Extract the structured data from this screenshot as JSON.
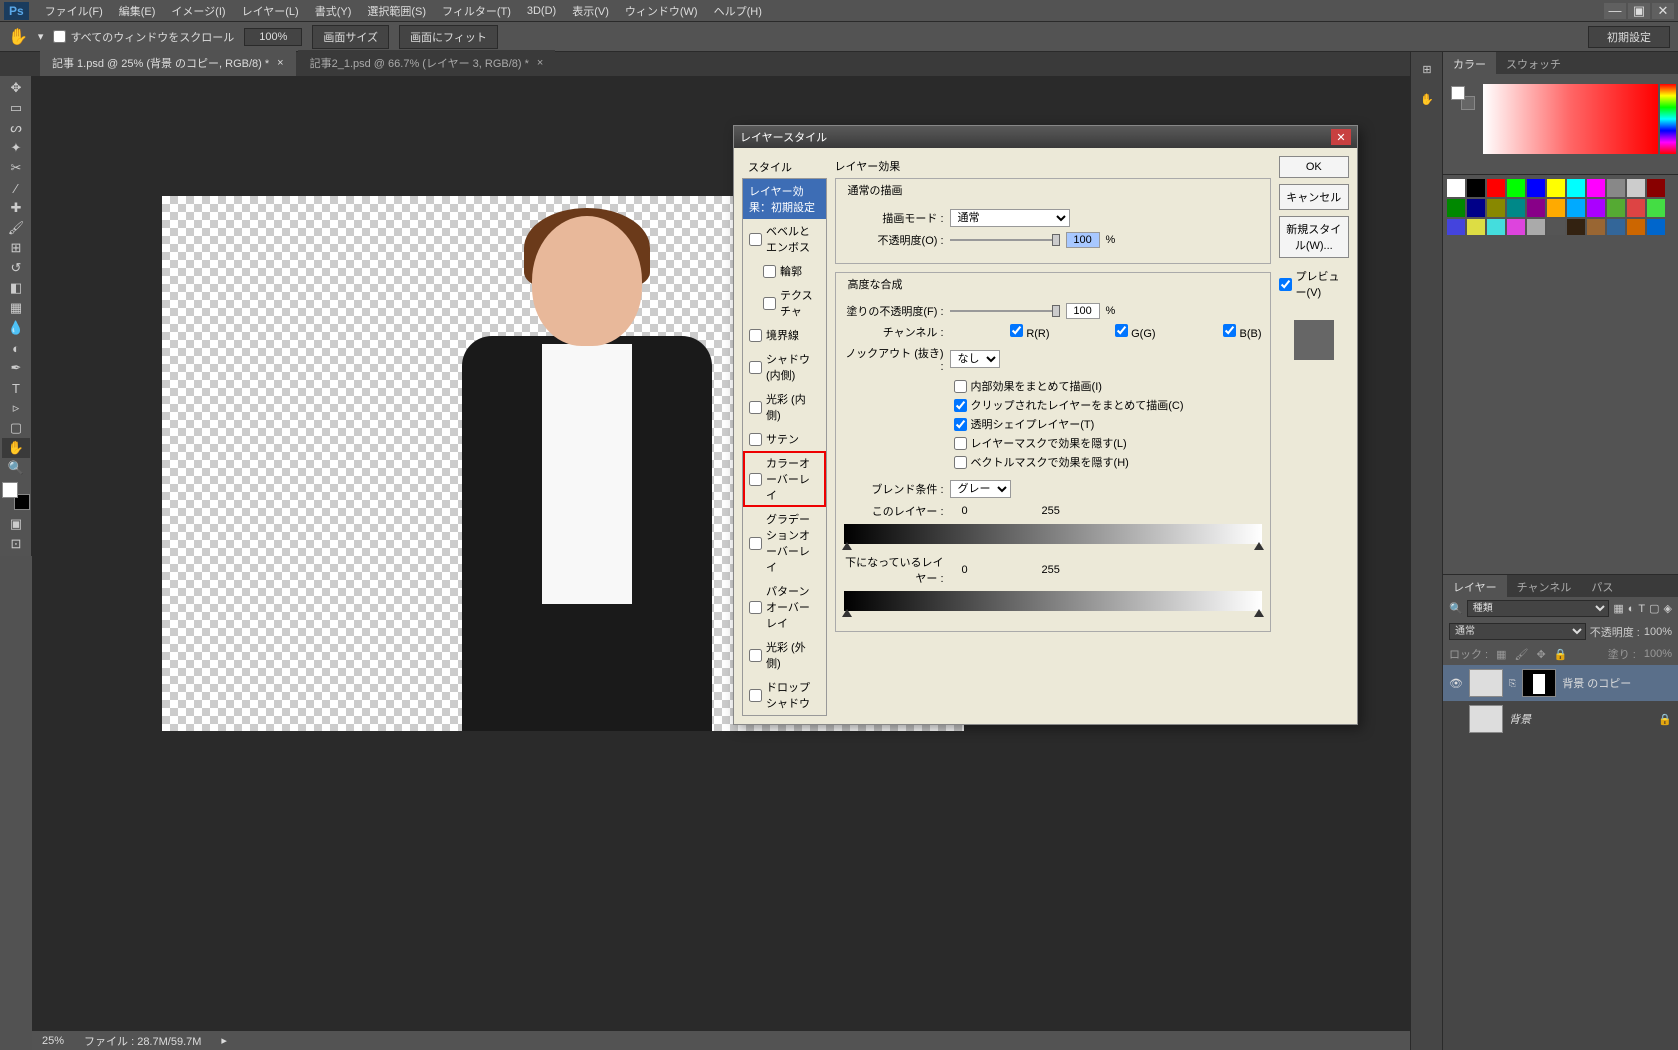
{
  "menubar": {
    "logo": "Ps",
    "items": [
      "ファイル(F)",
      "編集(E)",
      "イメージ(I)",
      "レイヤー(L)",
      "書式(Y)",
      "選択範囲(S)",
      "フィルター(T)",
      "3D(D)",
      "表示(V)",
      "ウィンドウ(W)",
      "ヘルプ(H)"
    ]
  },
  "options": {
    "scroll_all": "すべてのウィンドウをスクロール",
    "zoom": "100%",
    "actual_pixels": "画面サイズ",
    "fit_screen": "画面にフィット",
    "preset": "初期設定"
  },
  "tabs": [
    {
      "label": "記事 1.psd @ 25% (背景 のコピー, RGB/8) *"
    },
    {
      "label": "記事2_1.psd @ 66.7% (レイヤー 3, RGB/8) *"
    }
  ],
  "status": {
    "zoom": "25%",
    "file": "ファイル : 28.7M/59.7M"
  },
  "panels": {
    "color_tab": "カラー",
    "swatches_tab": "スウォッチ",
    "layers_tab": "レイヤー",
    "channels_tab": "チャンネル",
    "paths_tab": "パス",
    "kind_label": "種類",
    "blend_normal": "通常",
    "opacity_label": "不透明度 :",
    "opacity_val": "100%",
    "lock_label": "ロック :",
    "fill_label": "塗り :",
    "fill_val": "100%",
    "layers": [
      {
        "name": "背景 のコピー",
        "selected": true
      },
      {
        "name": "背景",
        "selected": false
      }
    ]
  },
  "dialog": {
    "title": "レイヤースタイル",
    "styles_head": "スタイル",
    "styles": [
      {
        "label": "レイヤー効果：初期設定",
        "selected": true,
        "check": false
      },
      {
        "label": "ベベルとエンボス",
        "check": true
      },
      {
        "label": "輪郭",
        "check": true,
        "indent": true
      },
      {
        "label": "テクスチャ",
        "check": true,
        "indent": true
      },
      {
        "label": "境界線",
        "check": true
      },
      {
        "label": "シャドウ (内側)",
        "check": true
      },
      {
        "label": "光彩 (内側)",
        "check": true
      },
      {
        "label": "サテン",
        "check": true
      },
      {
        "label": "カラーオーバーレイ",
        "check": true,
        "highlight": true
      },
      {
        "label": "グラデーションオーバーレイ",
        "check": true
      },
      {
        "label": "パターンオーバーレイ",
        "check": true
      },
      {
        "label": "光彩 (外側)",
        "check": true
      },
      {
        "label": "ドロップシャドウ",
        "check": true
      }
    ],
    "effects_head": "レイヤー効果",
    "normal_blend_head": "通常の描画",
    "blend_mode_label": "描画モード :",
    "blend_mode_val": "通常",
    "opacity_label": "不透明度(O) :",
    "opacity_val": "100",
    "adv_head": "高度な合成",
    "fill_opacity_label": "塗りの不透明度(F) :",
    "fill_opacity_val": "100",
    "channel_label": "チャンネル :",
    "ch_r": "R(R)",
    "ch_g": "G(G)",
    "ch_b": "B(B)",
    "knockout_label": "ノックアウト (抜き) :",
    "knockout_val": "なし",
    "chk1": "内部効果をまとめて描画(I)",
    "chk2": "クリップされたレイヤーをまとめて描画(C)",
    "chk3": "透明シェイプレイヤー(T)",
    "chk4": "レイヤーマスクで効果を隠す(L)",
    "chk5": "ベクトルマスクで効果を隠す(H)",
    "blendif_label": "ブレンド条件 :",
    "blendif_val": "グレー",
    "this_layer": "このレイヤー :",
    "under_layer": "下になっているレイヤー :",
    "range_lo": "0",
    "range_hi": "255",
    "ok": "OK",
    "cancel": "キャンセル",
    "new_style": "新規スタイル(W)...",
    "preview": "プレビュー(V)",
    "percent": "%"
  },
  "swatch_colors": [
    "#fff",
    "#000",
    "#f00",
    "#0f0",
    "#00f",
    "#ff0",
    "#0ff",
    "#f0f",
    "#888",
    "#ccc",
    "#800",
    "#080",
    "#008",
    "#880",
    "#088",
    "#808",
    "#fa0",
    "#0af",
    "#a0f",
    "#5a3",
    "#d44",
    "#4d4",
    "#44d",
    "#dd4",
    "#4dd",
    "#d4d",
    "#aaa",
    "#555",
    "#321",
    "#963",
    "#369",
    "#c60",
    "#06c",
    "#60c",
    "#1a1a1a",
    "#333",
    "#555",
    "#777",
    "#999",
    "#bbb",
    "#ddd",
    "#f55",
    "#5f5",
    "#55f"
  ]
}
